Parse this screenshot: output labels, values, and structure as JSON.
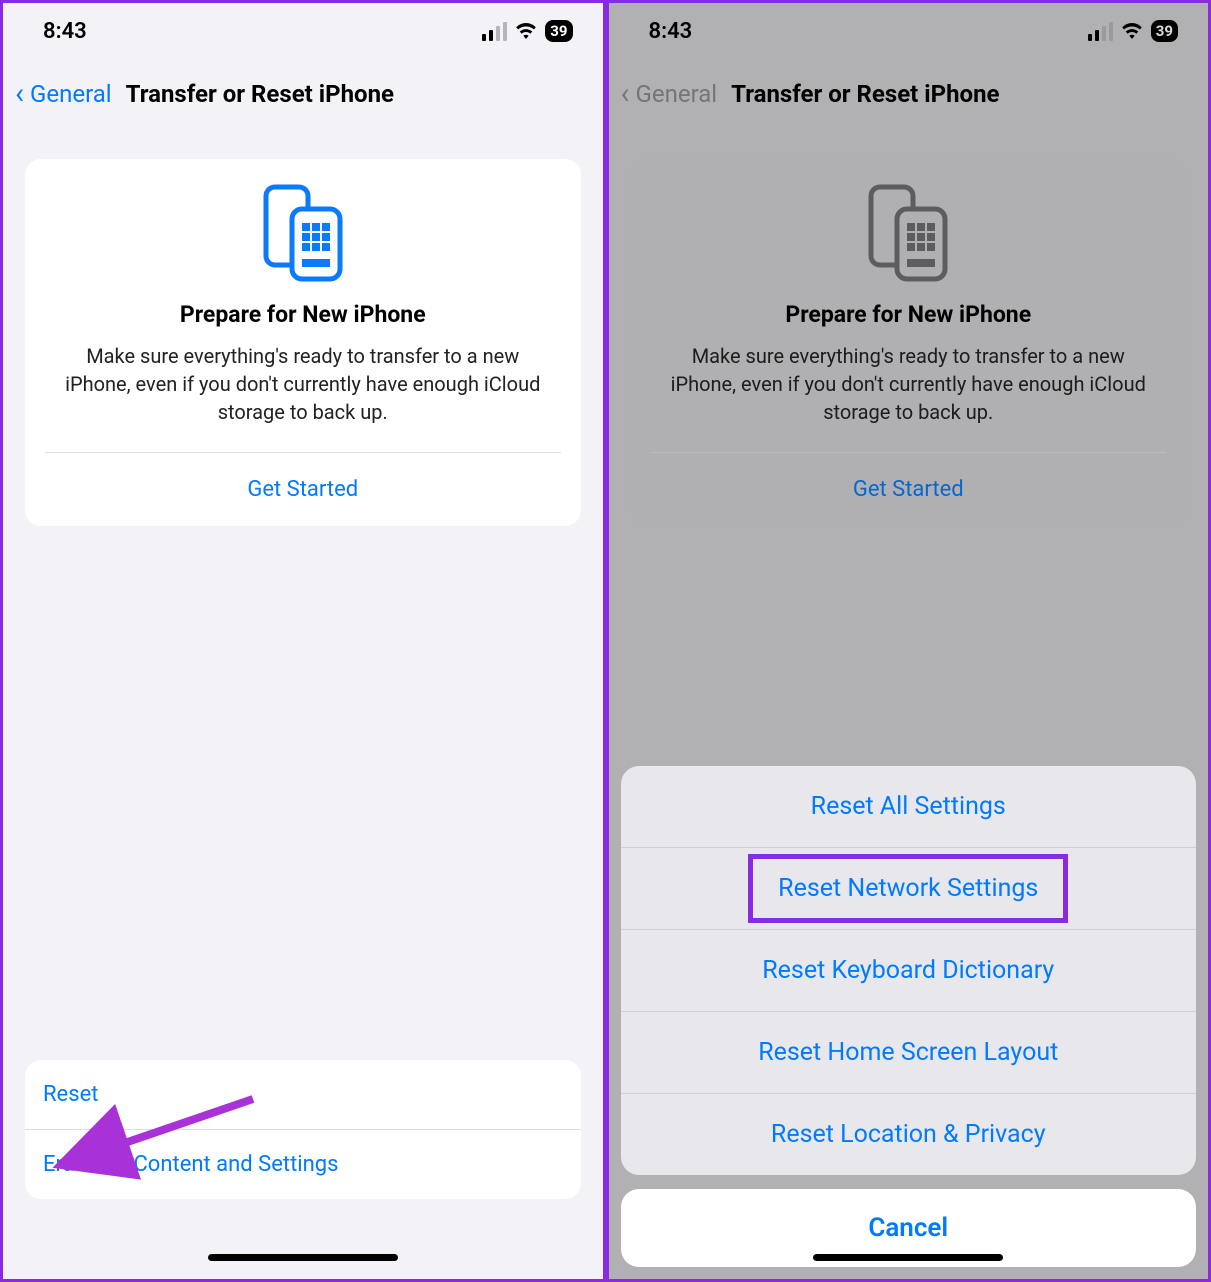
{
  "status": {
    "time": "8:43",
    "battery": "39"
  },
  "nav": {
    "back_label": "General",
    "title": "Transfer or Reset iPhone"
  },
  "prepare": {
    "title": "Prepare for New iPhone",
    "description": "Make sure everything's ready to transfer to a new iPhone, even if you don't currently have enough iCloud storage to back up.",
    "cta": "Get Started"
  },
  "bottom": {
    "reset": "Reset",
    "erase": "Erase All Content and Settings"
  },
  "sheet": {
    "options": [
      "Reset All Settings",
      "Reset Network Settings",
      "Reset Keyboard Dictionary",
      "Reset Home Screen Layout",
      "Reset Location & Privacy"
    ],
    "cancel": "Cancel",
    "highlighted_index": 1
  },
  "annotation": {
    "arrow_target": "reset-row"
  }
}
